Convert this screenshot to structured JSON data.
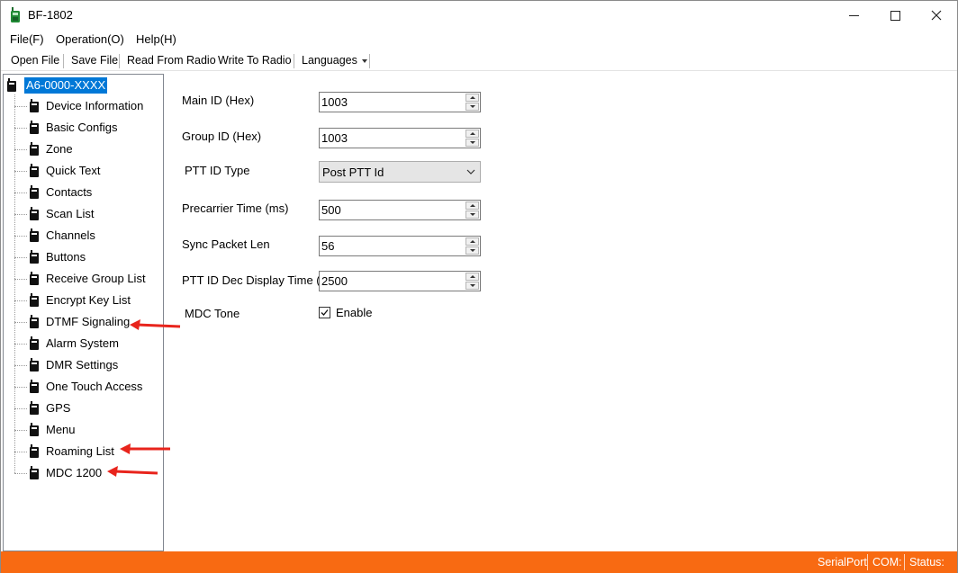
{
  "window": {
    "title": "BF-1802"
  },
  "menu": {
    "file": "File(F)",
    "operation": "Operation(O)",
    "help": "Help(H)"
  },
  "toolbar": {
    "open_file": "Open File",
    "save_file": "Save File",
    "read_from_radio": "Read From Radio",
    "write_to_radio": "Write To Radio",
    "languages": "Languages"
  },
  "tree": {
    "root": "A6-0000-XXXX",
    "items": [
      {
        "label": "Device Information"
      },
      {
        "label": "Basic Configs"
      },
      {
        "label": "Zone"
      },
      {
        "label": "Quick Text"
      },
      {
        "label": "Contacts"
      },
      {
        "label": "Scan List"
      },
      {
        "label": "Channels"
      },
      {
        "label": "Buttons"
      },
      {
        "label": "Receive Group List"
      },
      {
        "label": "Encrypt Key List"
      },
      {
        "label": "DTMF Signaling"
      },
      {
        "label": "Alarm System"
      },
      {
        "label": "DMR Settings"
      },
      {
        "label": "One Touch Access"
      },
      {
        "label": "GPS"
      },
      {
        "label": "Menu"
      },
      {
        "label": "Roaming List"
      },
      {
        "label": "MDC 1200"
      }
    ]
  },
  "form": {
    "main_id_label": "Main ID (Hex)",
    "main_id_value": "1003",
    "group_id_label": "Group ID (Hex)",
    "group_id_value": "1003",
    "ptt_id_type_label": "PTT ID Type",
    "ptt_id_type_value": "Post PTT Id",
    "precarrier_label": "Precarrier Time (ms)",
    "precarrier_value": "500",
    "sync_packet_label": "Sync Packet Len",
    "sync_packet_value": "56",
    "ptt_dec_label": "PTT ID Dec Display Time (",
    "ptt_dec_value": "2500",
    "mdc_tone_label": "MDC Tone",
    "mdc_tone_checkbox_label": "Enable",
    "mdc_tone_checked": true
  },
  "status": {
    "serial_port": "SerialPort",
    "com": "COM:",
    "status": "Status:"
  },
  "colors": {
    "status_bar": "#f86a12",
    "selection": "#0078d7",
    "annotation_arrow": "#e8241c"
  }
}
